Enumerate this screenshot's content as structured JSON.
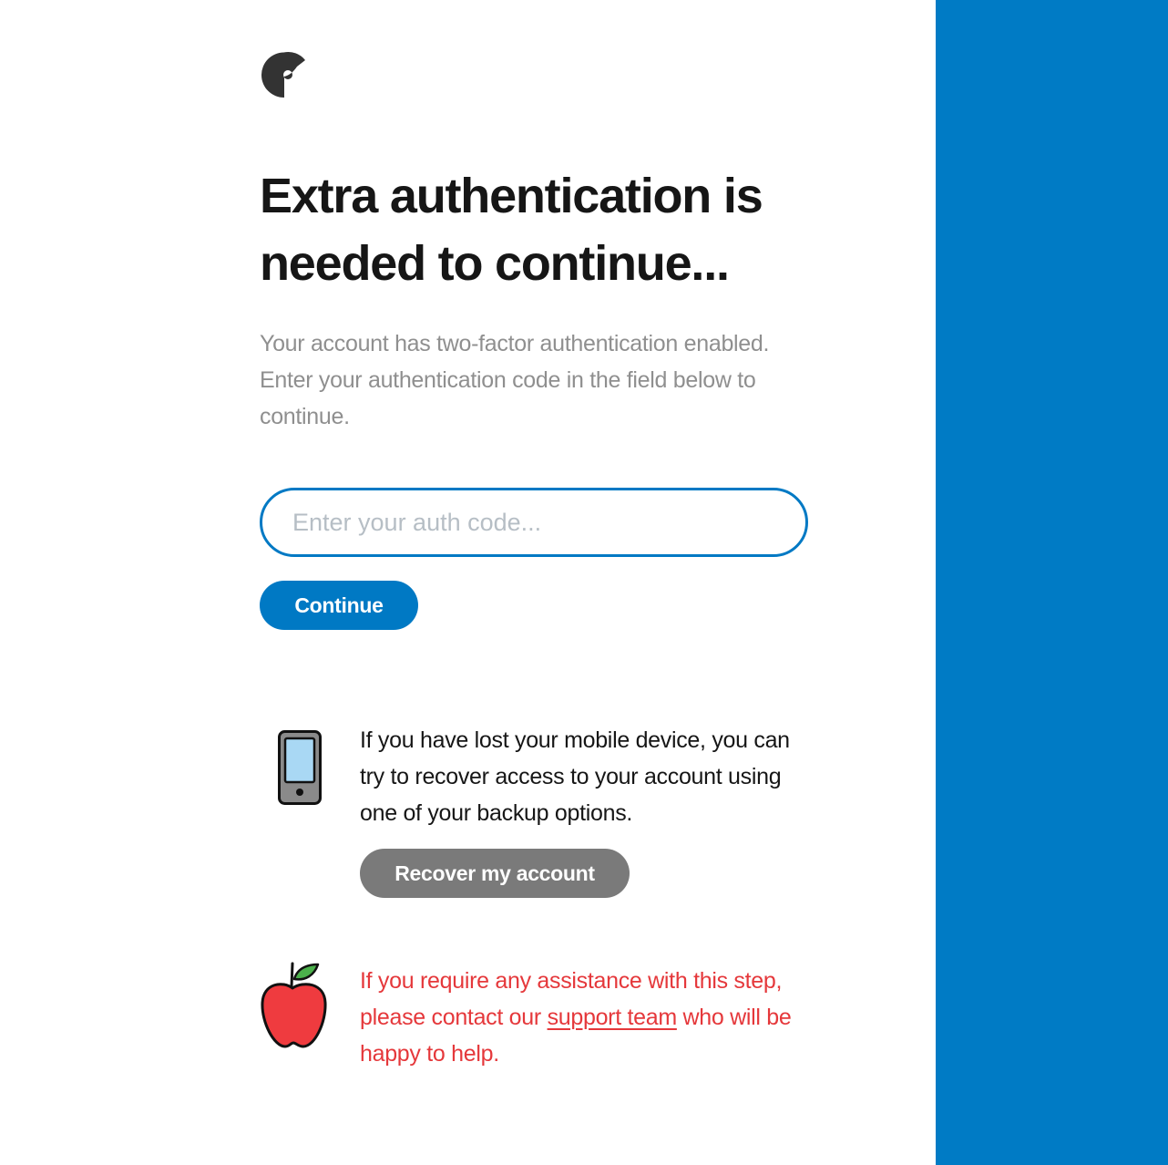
{
  "page": {
    "title_line1": "Extra authentication is",
    "title_line2": "needed to continue..."
  },
  "intro": {
    "text": "Your account has two-factor authentication enabled. Enter your authentication code in the field below to continue."
  },
  "form": {
    "auth_code_value": "",
    "auth_code_placeholder": "Enter your auth code...",
    "continue_label": "Continue"
  },
  "recovery": {
    "icon": "mobile-phone-icon",
    "text": "If you have lost your mobile device, you can try to recover access to your account using one of your backup options.",
    "button_label": "Recover my account"
  },
  "help": {
    "icon": "apple-icon",
    "text_before": "If you require any assistance with this step, please contact our",
    "link_label": "support team",
    "text_after": "who will be happy to help."
  },
  "colors": {
    "accent": "#0079c4",
    "side_panel": "#007bc5",
    "secondary_button": "#7a7a7a",
    "help_text": "#e5383b",
    "logo": "#333333"
  }
}
